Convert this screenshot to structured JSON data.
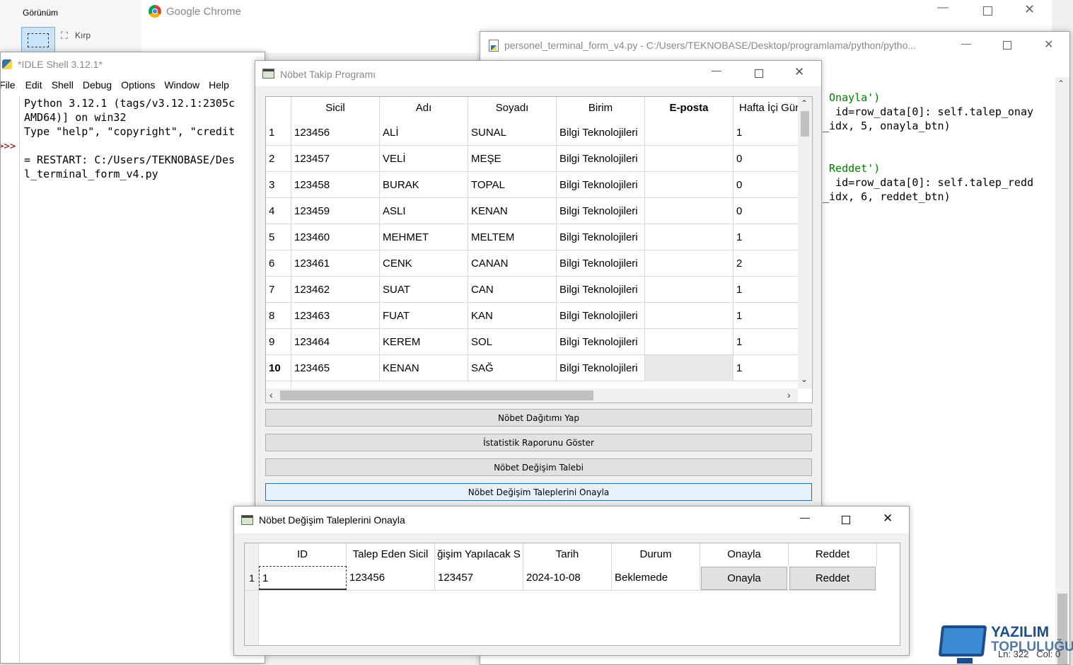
{
  "paint": {
    "tab_label": "Görünüm",
    "crop_label": "Kırp"
  },
  "chrome": {
    "title": "Google Chrome"
  },
  "editor": {
    "title": "personel_terminal_form_v4.py - C:/Users/TEKNOBASE/Desktop/programlama/python/pytho...",
    "code_lines": [
      " Onayla')",
      "  id=row_data[0]: self.talep_onay",
      "_idx, 5, onayla_btn)",
      "",
      "",
      " Reddet')",
      "  id=row_data[0]: self.talep_redd",
      "_idx, 6, reddet_btn)"
    ],
    "status": "Ln: 322   Col: 0"
  },
  "idle": {
    "title": "*IDLE Shell 3.12.1*",
    "menu": [
      "File",
      "Edit",
      "Shell",
      "Debug",
      "Options",
      "Window",
      "Help"
    ],
    "prompt": ">>>",
    "lines": [
      "Python 3.12.1 (tags/v3.12.1:2305c",
      "AMD64)] on win32",
      "Type \"help\", \"copyright\", \"credit",
      "",
      "= RESTART: C:/Users/TEKNOBASE/Des",
      "l_terminal_form_v4.py"
    ]
  },
  "main_window": {
    "title": "Nöbet Takip Programı",
    "columns": [
      "Sicil",
      "Adı",
      "Soyadı",
      "Birim",
      "E-posta",
      "Hafta İçi Gün"
    ],
    "rows": [
      {
        "n": "1",
        "sicil": "123456",
        "ad": "ALİ",
        "soyad": "SUNAL",
        "birim": "Bilgi Teknolojileri",
        "eposta": "",
        "hafta": "1"
      },
      {
        "n": "2",
        "sicil": "123457",
        "ad": "VELİ",
        "soyad": "MEŞE",
        "birim": "Bilgi Teknolojileri",
        "eposta": "",
        "hafta": "0"
      },
      {
        "n": "3",
        "sicil": "123458",
        "ad": "BURAK",
        "soyad": "TOPAL",
        "birim": "Bilgi Teknolojileri",
        "eposta": "",
        "hafta": "0"
      },
      {
        "n": "4",
        "sicil": "123459",
        "ad": "ASLI",
        "soyad": "KENAN",
        "birim": "Bilgi Teknolojileri",
        "eposta": "",
        "hafta": "0"
      },
      {
        "n": "5",
        "sicil": "123460",
        "ad": "MEHMET",
        "soyad": "MELTEM",
        "birim": "Bilgi Teknolojileri",
        "eposta": "",
        "hafta": "1"
      },
      {
        "n": "6",
        "sicil": "123461",
        "ad": "CENK",
        "soyad": "CANAN",
        "birim": "Bilgi Teknolojileri",
        "eposta": "",
        "hafta": "2"
      },
      {
        "n": "7",
        "sicil": "123462",
        "ad": "SUAT",
        "soyad": "CAN",
        "birim": "Bilgi Teknolojileri",
        "eposta": "",
        "hafta": "1"
      },
      {
        "n": "8",
        "sicil": "123463",
        "ad": "FUAT",
        "soyad": "KAN",
        "birim": "Bilgi Teknolojileri",
        "eposta": "",
        "hafta": "1"
      },
      {
        "n": "9",
        "sicil": "123464",
        "ad": "KEREM",
        "soyad": "SOL",
        "birim": "Bilgi Teknolojileri",
        "eposta": "",
        "hafta": "1"
      },
      {
        "n": "10",
        "sicil": "123465",
        "ad": "KENAN",
        "soyad": "SAĞ",
        "birim": "Bilgi Teknolojileri",
        "eposta": "",
        "hafta": "1"
      }
    ],
    "buttons": [
      "Nöbet Dağıtımı Yap",
      "İstatistik Raporunu Göster",
      "Nöbet Değişim Talebi",
      "Nöbet Değişim Taleplerini Onayla"
    ]
  },
  "dialog": {
    "title": "Nöbet Değişim Taleplerini Onayla",
    "columns": [
      "ID",
      "Talep Eden Sicil",
      "ğişim Yapılacak S",
      "Tarih",
      "Durum",
      "Onayla",
      "Reddet"
    ],
    "rows": [
      {
        "n": "1",
        "id": "1",
        "talep": "123456",
        "degisim": "123457",
        "tarih": "2024-10-08",
        "durum": "Beklemede",
        "onayla": "Onayla",
        "reddet": "Reddet"
      }
    ]
  },
  "logo": {
    "line1": "YAZILIM",
    "line2": "TOPLULUĞU"
  },
  "colors": {
    "accent": "#0078d7",
    "logo_blue": "#1d4e89"
  }
}
